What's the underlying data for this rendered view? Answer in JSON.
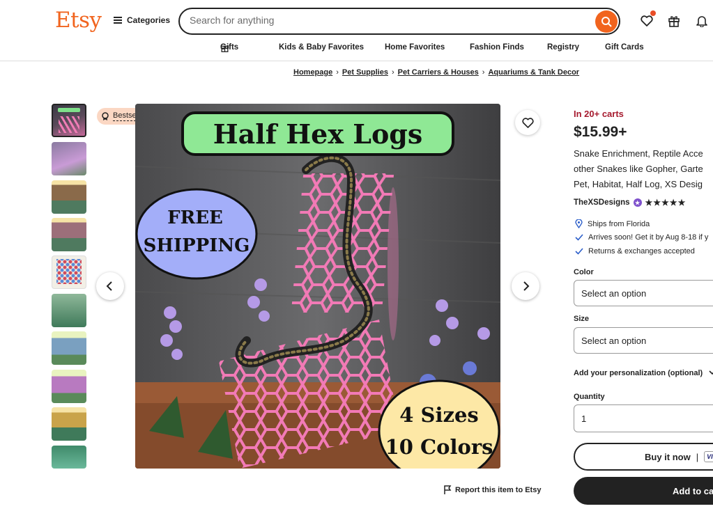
{
  "header": {
    "logo": "Etsy",
    "categories_label": "Categories",
    "search_placeholder": "Search for anything",
    "nav": [
      {
        "label": "Gifts"
      },
      {
        "label": "Kids & Baby Favorites"
      },
      {
        "label": "Home Favorites"
      },
      {
        "label": "Fashion Finds"
      },
      {
        "label": "Registry"
      },
      {
        "label": "Gift Cards"
      }
    ],
    "icons": [
      "search-icon",
      "heart-icon",
      "gift-icon",
      "bell-icon",
      "hamburger-icon"
    ]
  },
  "breadcrumb": [
    "Homepage",
    "Pet Supplies",
    "Pet Carriers & Houses",
    "Aquariums & Tank Decor"
  ],
  "gallery": {
    "badge": "Bestseller",
    "hero_banner": "Half Hex Logs",
    "hero_circle_left": [
      "FREE",
      "SHIPPING"
    ],
    "hero_circle_right": [
      "4 Sizes",
      "10 Colors"
    ],
    "thumb_count": 10,
    "report_label": "Report this item to Etsy"
  },
  "product": {
    "in_carts": "In 20+ carts",
    "price": "$15.99+",
    "title_lines": [
      "Snake Enrichment, Reptile Acce",
      "other Snakes like Gopher, Garte",
      "Pet, Habitat, Half Log, XS Desig"
    ],
    "shop_name": "TheXSDesigns",
    "rating_stars": "★★★★★",
    "features": [
      {
        "text": "Ships from Florida",
        "icon": "location-pin-icon"
      },
      {
        "text": "Arrives soon! Get it by Aug 8-18 if y",
        "icon": "check-icon"
      },
      {
        "text": "Returns & exchanges accepted",
        "icon": "check-icon"
      }
    ],
    "color_label": "Color",
    "color_value": "Select an option",
    "size_label": "Size",
    "size_value": "Select an option",
    "personalization_label": "Add your personalization (optional)",
    "quantity_label": "Quantity",
    "quantity_value": "1",
    "buy_now_label": "Buy it now",
    "buy_now_sep": "|",
    "payment_badge": "VISA",
    "add_to_cart_label": "Add to ca"
  },
  "colors": {
    "brand": "#f1641e",
    "carts_red": "#a61a2e",
    "badge_bg": "#fbd7c3",
    "dark": "#222222"
  }
}
